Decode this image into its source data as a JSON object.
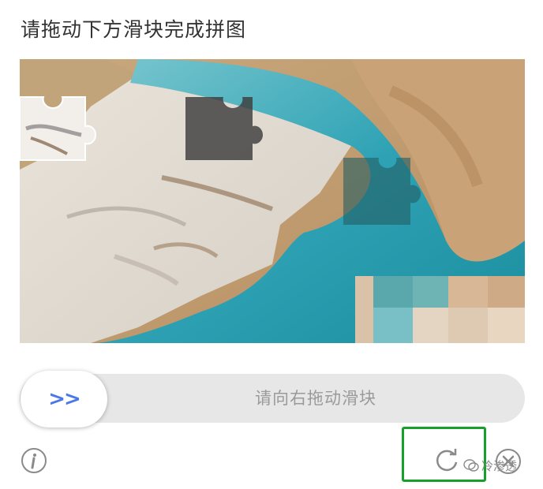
{
  "captcha": {
    "title": "请拖动下方滑块完成拼图",
    "slider_hint": "请向右拖动滑块",
    "knob_glyph": ">>",
    "colors": {
      "accent": "#4a78e6",
      "track": "#e7e7e7",
      "hint_text": "#9a9a9a",
      "highlight_box": "#17a02c"
    }
  },
  "footer": {
    "info_icon": "info-icon",
    "refresh_icon": "refresh-icon",
    "close_icon": "close-icon",
    "watermark_text": "冷渗透"
  }
}
